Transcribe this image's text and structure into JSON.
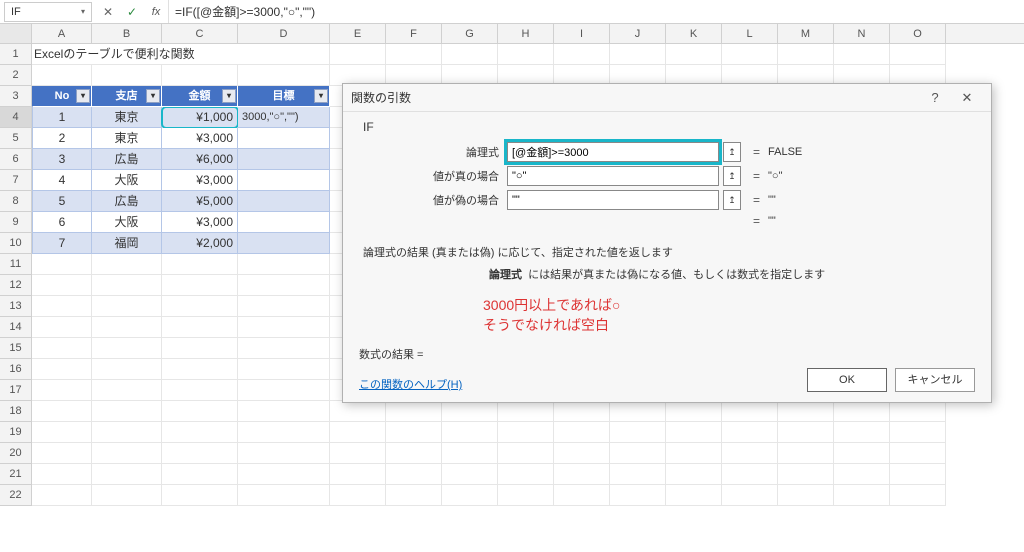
{
  "formula_bar": {
    "name_box": "IF",
    "formula": "=IF([@金額]>=3000,\"○\",\"\")"
  },
  "columns": [
    "A",
    "B",
    "C",
    "D",
    "E",
    "F",
    "G",
    "H",
    "I",
    "J",
    "K",
    "L",
    "M",
    "N",
    "O"
  ],
  "a1_title": "Excelのテーブルで便利な関数",
  "table": {
    "headers": {
      "no": "No",
      "branch": "支店",
      "amount": "金額",
      "goal": "目標"
    },
    "d4_preview": "3000,\"○\",\"\")",
    "rows": [
      {
        "no": "1",
        "branch": "東京",
        "amount": "¥1,000"
      },
      {
        "no": "2",
        "branch": "東京",
        "amount": "¥3,000"
      },
      {
        "no": "3",
        "branch": "広島",
        "amount": "¥6,000"
      },
      {
        "no": "4",
        "branch": "大阪",
        "amount": "¥3,000"
      },
      {
        "no": "5",
        "branch": "広島",
        "amount": "¥5,000"
      },
      {
        "no": "6",
        "branch": "大阪",
        "amount": "¥3,000"
      },
      {
        "no": "7",
        "branch": "福岡",
        "amount": "¥2,000"
      }
    ]
  },
  "dialog": {
    "title": "関数の引数",
    "fn": "IF",
    "args": {
      "logical": {
        "label": "論理式",
        "value": "[@金額]>=3000",
        "result": "FALSE"
      },
      "true": {
        "label": "値が真の場合",
        "value": "\"○\"",
        "result": "\"○\""
      },
      "false": {
        "label": "値が偽の場合",
        "value": "\"\"",
        "result": "\"\""
      }
    },
    "final_result": "\"\"",
    "desc1": "論理式の結果 (真または偽) に応じて、指定された値を返します",
    "desc2_bold": "論理式",
    "desc2_rest": "には結果が真または偽になる値、もしくは数式を指定します",
    "annot_line1": "3000円以上であれば○",
    "annot_line2": "そうでなければ空白",
    "result_label": "数式の結果 =",
    "help": "この関数のヘルプ(H)",
    "ok": "OK",
    "cancel": "キャンセル"
  }
}
